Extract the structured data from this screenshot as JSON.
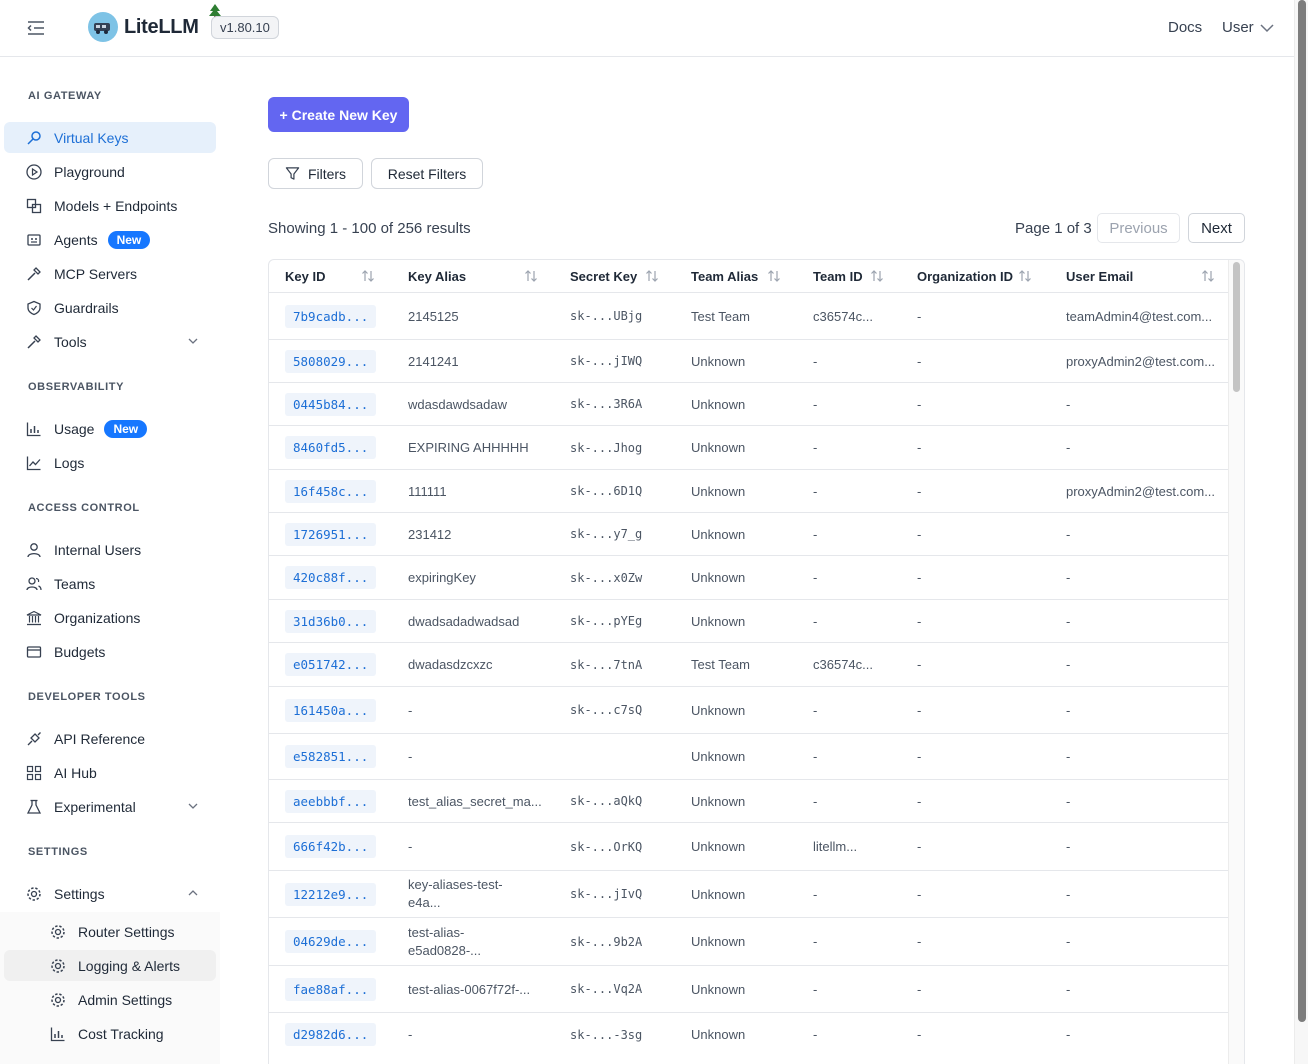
{
  "header": {
    "app_name": "LiteLLM",
    "version": "v1.80.10",
    "docs": "Docs",
    "user": "User"
  },
  "sidebar": {
    "sections": {
      "ai_gateway": "AI GATEWAY",
      "observability": "OBSERVABILITY",
      "access_control": "ACCESS CONTROL",
      "developer_tools": "DEVELOPER TOOLS",
      "settings": "SETTINGS"
    },
    "items": {
      "virtual_keys": "Virtual Keys",
      "playground": "Playground",
      "models": "Models + Endpoints",
      "agents": "Agents",
      "mcp": "MCP Servers",
      "guardrails": "Guardrails",
      "tools": "Tools",
      "usage": "Usage",
      "logs": "Logs",
      "internal_users": "Internal Users",
      "teams": "Teams",
      "organizations": "Organizations",
      "budgets": "Budgets",
      "api_reference": "API Reference",
      "ai_hub": "AI Hub",
      "experimental": "Experimental",
      "settings": "Settings",
      "router_settings": "Router Settings",
      "logging_alerts": "Logging & Alerts",
      "admin_settings": "Admin Settings",
      "cost_tracking": "Cost Tracking"
    },
    "new_badge": "New"
  },
  "toolbar": {
    "create_key": "+ Create New Key",
    "filters": "Filters",
    "reset_filters": "Reset Filters"
  },
  "pagination": {
    "showing": "Showing 1 - 100 of 256 results",
    "page": "Page 1 of 3",
    "previous": "Previous",
    "next": "Next"
  },
  "table": {
    "columns": [
      "Key ID",
      "Key Alias",
      "Secret Key",
      "Team Alias",
      "Team ID",
      "Organization ID",
      "User Email"
    ],
    "rows": [
      {
        "key_id": "7b9cadb...",
        "alias": "2145125",
        "secret": "sk-...UBjg",
        "team_alias": "Test Team",
        "team_id": "c36574c...",
        "org_id": "-",
        "email": "teamAdmin4@test.com..."
      },
      {
        "key_id": "5808029...",
        "alias": "2141241",
        "secret": "sk-...jIWQ",
        "team_alias": "Unknown",
        "team_id": "-",
        "org_id": "-",
        "email": "proxyAdmin2@test.com..."
      },
      {
        "key_id": "0445b84...",
        "alias": "wdasdawdsadaw",
        "secret": "sk-...3R6A",
        "team_alias": "Unknown",
        "team_id": "-",
        "org_id": "-",
        "email": "-"
      },
      {
        "key_id": "8460fd5...",
        "alias": "EXPIRING AHHHHH",
        "secret": "sk-...Jhog",
        "team_alias": "Unknown",
        "team_id": "-",
        "org_id": "-",
        "email": "-"
      },
      {
        "key_id": "16f458c...",
        "alias": "111111",
        "secret": "sk-...6D1Q",
        "team_alias": "Unknown",
        "team_id": "-",
        "org_id": "-",
        "email": "proxyAdmin2@test.com..."
      },
      {
        "key_id": "1726951...",
        "alias": "231412",
        "secret": "sk-...y7_g",
        "team_alias": "Unknown",
        "team_id": "-",
        "org_id": "-",
        "email": "-"
      },
      {
        "key_id": "420c88f...",
        "alias": "expiringKey",
        "secret": "sk-...x0Zw",
        "team_alias": "Unknown",
        "team_id": "-",
        "org_id": "-",
        "email": "-"
      },
      {
        "key_id": "31d36b0...",
        "alias": "dwadsadadwadsad",
        "secret": "sk-...pYEg",
        "team_alias": "Unknown",
        "team_id": "-",
        "org_id": "-",
        "email": "-"
      },
      {
        "key_id": "e051742...",
        "alias": "dwadasdzcxzc",
        "secret": "sk-...7tnA",
        "team_alias": "Test Team",
        "team_id": "c36574c...",
        "org_id": "-",
        "email": "-"
      },
      {
        "key_id": "161450a...",
        "alias": "-",
        "secret": "sk-...c7sQ",
        "team_alias": "Unknown",
        "team_id": "-",
        "org_id": "-",
        "email": "-"
      },
      {
        "key_id": "e582851...",
        "alias": "-",
        "secret": "",
        "team_alias": "Unknown",
        "team_id": "-",
        "org_id": "-",
        "email": "-"
      },
      {
        "key_id": "aeebbbf...",
        "alias": "test_alias_secret_ma...",
        "secret": "sk-...aQkQ",
        "team_alias": "Unknown",
        "team_id": "-",
        "org_id": "-",
        "email": "-"
      },
      {
        "key_id": "666f42b...",
        "alias": "-",
        "secret": "sk-...OrKQ",
        "team_alias": "Unknown",
        "team_id": "litellm...",
        "org_id": "-",
        "email": "-"
      },
      {
        "key_id": "12212e9...",
        "alias": "key-aliases-test-",
        "alias2": "e4a...",
        "secret": "sk-...jIvQ",
        "team_alias": "Unknown",
        "team_id": "-",
        "org_id": "-",
        "email": "-"
      },
      {
        "key_id": "04629de...",
        "alias": "test-alias-",
        "alias2": "e5ad0828-...",
        "secret": "sk-...9b2A",
        "team_alias": "Unknown",
        "team_id": "-",
        "org_id": "-",
        "email": "-"
      },
      {
        "key_id": "fae88af...",
        "alias": "test-alias-0067f72f-...",
        "secret": "sk-...Vq2A",
        "team_alias": "Unknown",
        "team_id": "-",
        "org_id": "-",
        "email": "-"
      },
      {
        "key_id": "d2982d6...",
        "alias": "-",
        "secret": "sk-...-3sg",
        "team_alias": "Unknown",
        "team_id": "-",
        "org_id": "-",
        "email": "-"
      }
    ]
  }
}
